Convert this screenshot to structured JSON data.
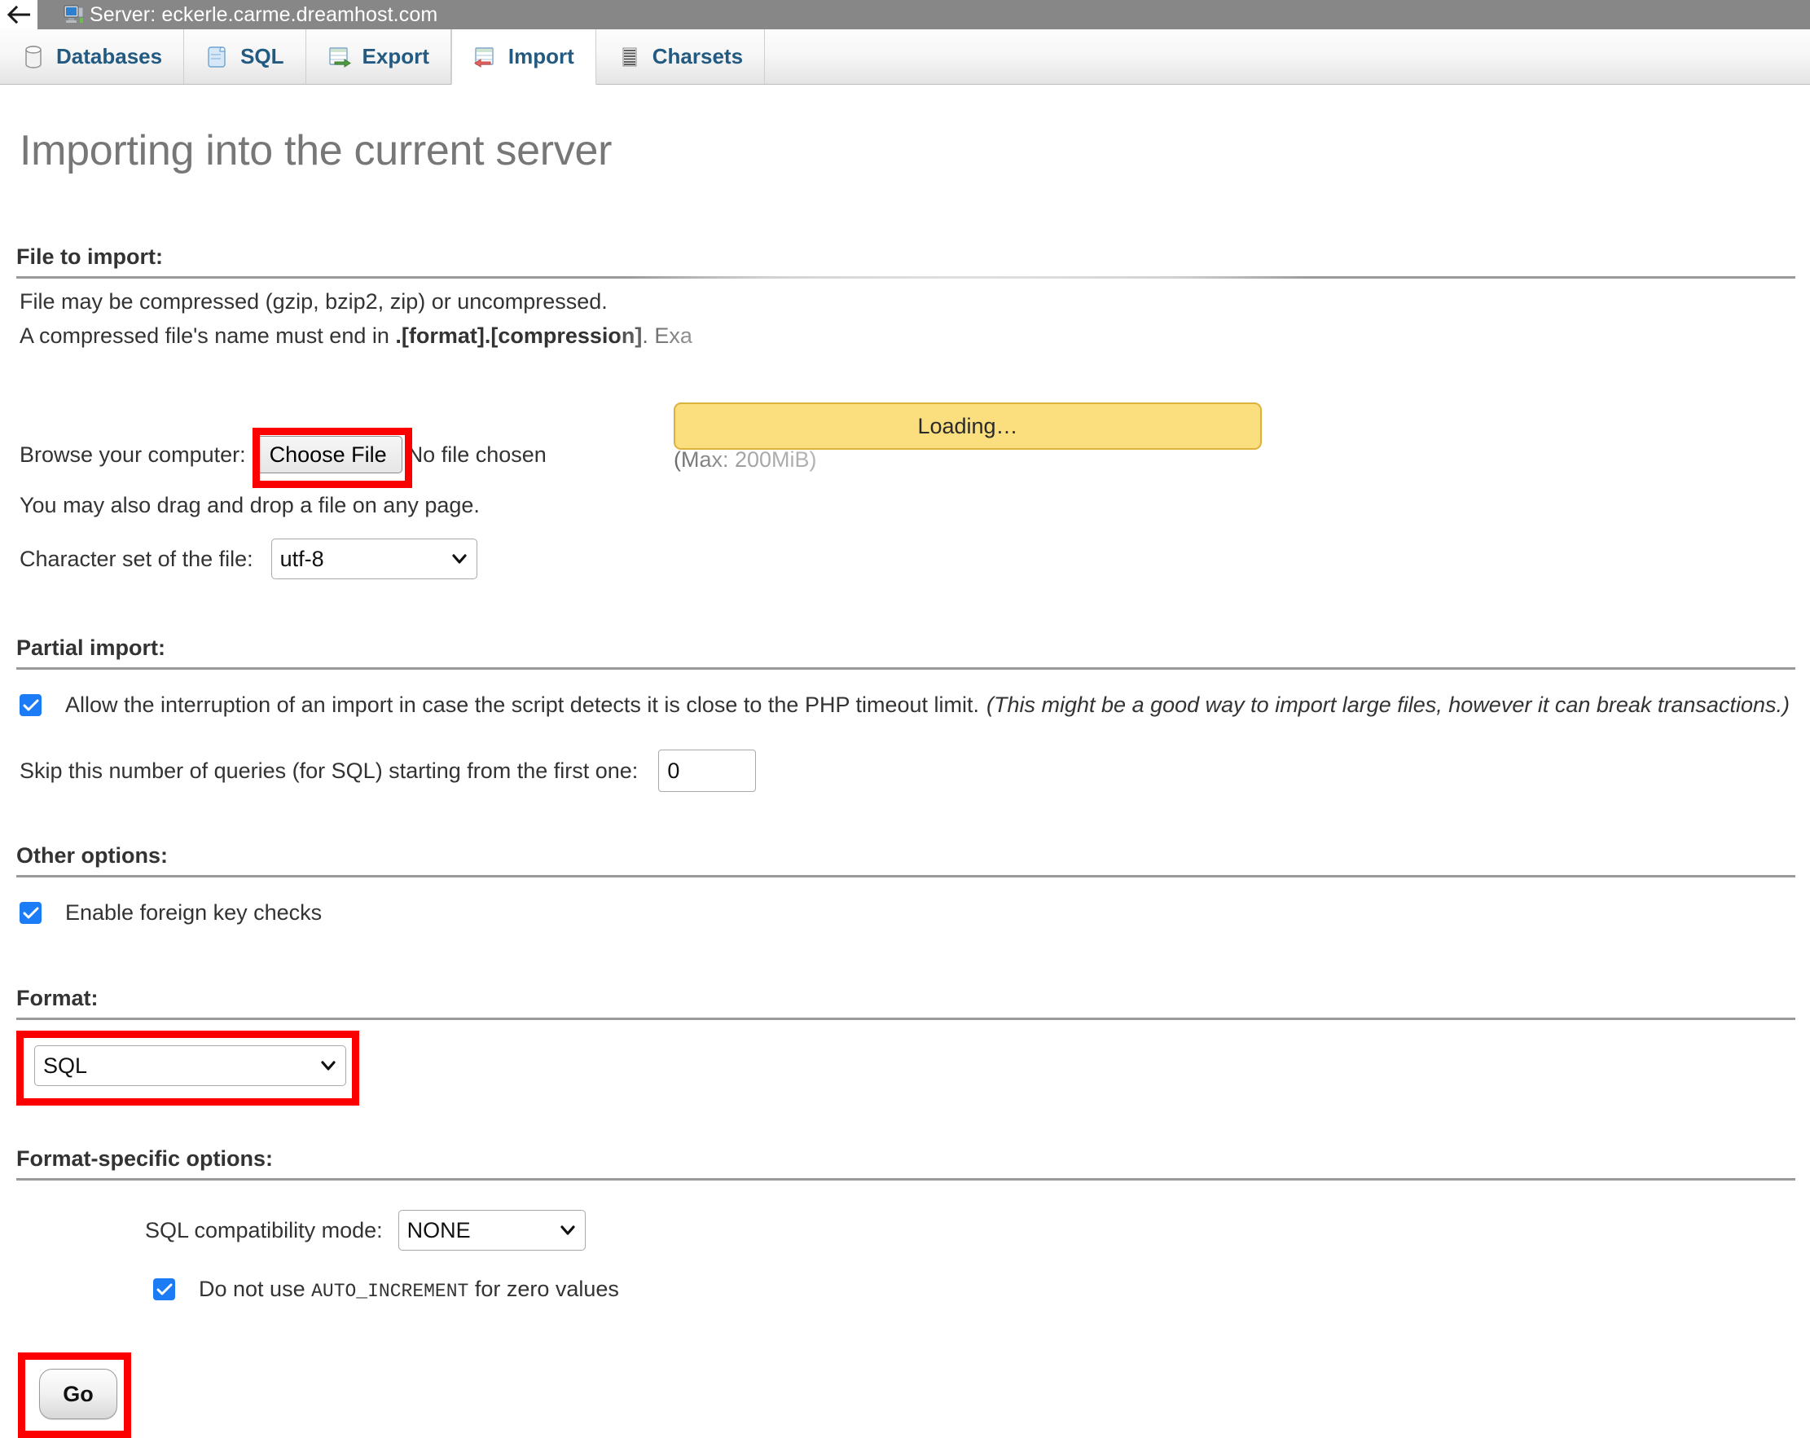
{
  "titlebar": {
    "back_icon": "back-arrow-icon",
    "server_icon": "server-monitor-icon",
    "title": "Server: eckerle.carme.dreamhost.com"
  },
  "tabs": [
    {
      "label": "Databases",
      "icon": "database-cylinder-icon",
      "active": false
    },
    {
      "label": "SQL",
      "icon": "sql-scroll-icon",
      "active": false
    },
    {
      "label": "Export",
      "icon": "export-table-icon",
      "active": false
    },
    {
      "label": "Import",
      "icon": "import-table-icon",
      "active": true
    },
    {
      "label": "Charsets",
      "icon": "charsets-lines-icon",
      "active": false
    }
  ],
  "page": {
    "title": "Importing into the current server"
  },
  "file_to_import": {
    "heading": "File to import:",
    "line1": "File may be compressed (gzip, bzip2, zip) or uncompressed.",
    "line2_a": "A compressed file's name must end in ",
    "line2_b": ".[format].[compression]",
    "line2_c": ". Exa",
    "browse_label": "Browse your computer:",
    "choose_file_button": "Choose File",
    "no_file_chosen": "No file chosen",
    "max_size": "(Max: 200MiB)",
    "drag_drop_note": "You may also drag and drop a file on any page.",
    "charset_label": "Character set of the file:",
    "charset_value": "utf-8"
  },
  "overlay": {
    "loading_text": "Loading…"
  },
  "partial_import": {
    "heading": "Partial import:",
    "allow_interruption_label": "Allow the interruption of an import in case the script detects it is close to the PHP timeout limit.",
    "allow_interruption_note": "(This might be a good way to import large files, however it can break transactions.)",
    "allow_interruption_checked": true,
    "skip_label": "Skip this number of queries (for SQL) starting from the first one:",
    "skip_value": "0"
  },
  "other_options": {
    "heading": "Other options:",
    "foreign_key_label": "Enable foreign key checks",
    "foreign_key_checked": true
  },
  "format": {
    "heading": "Format:",
    "value": "SQL"
  },
  "format_specific": {
    "heading": "Format-specific options:",
    "compat_label": "SQL compatibility mode:",
    "compat_value": "NONE",
    "auto_increment_prefix": "Do not use ",
    "auto_increment_code": "AUTO_INCREMENT",
    "auto_increment_suffix": " for zero values",
    "auto_increment_checked": true
  },
  "submit": {
    "go_label": "Go"
  },
  "colors": {
    "highlight": "#fc0000",
    "tab_link": "#235a81",
    "titlebar_bg": "#878787",
    "loading_bg": "#fbde7e",
    "checkbox_blue": "#1b7cf5"
  }
}
